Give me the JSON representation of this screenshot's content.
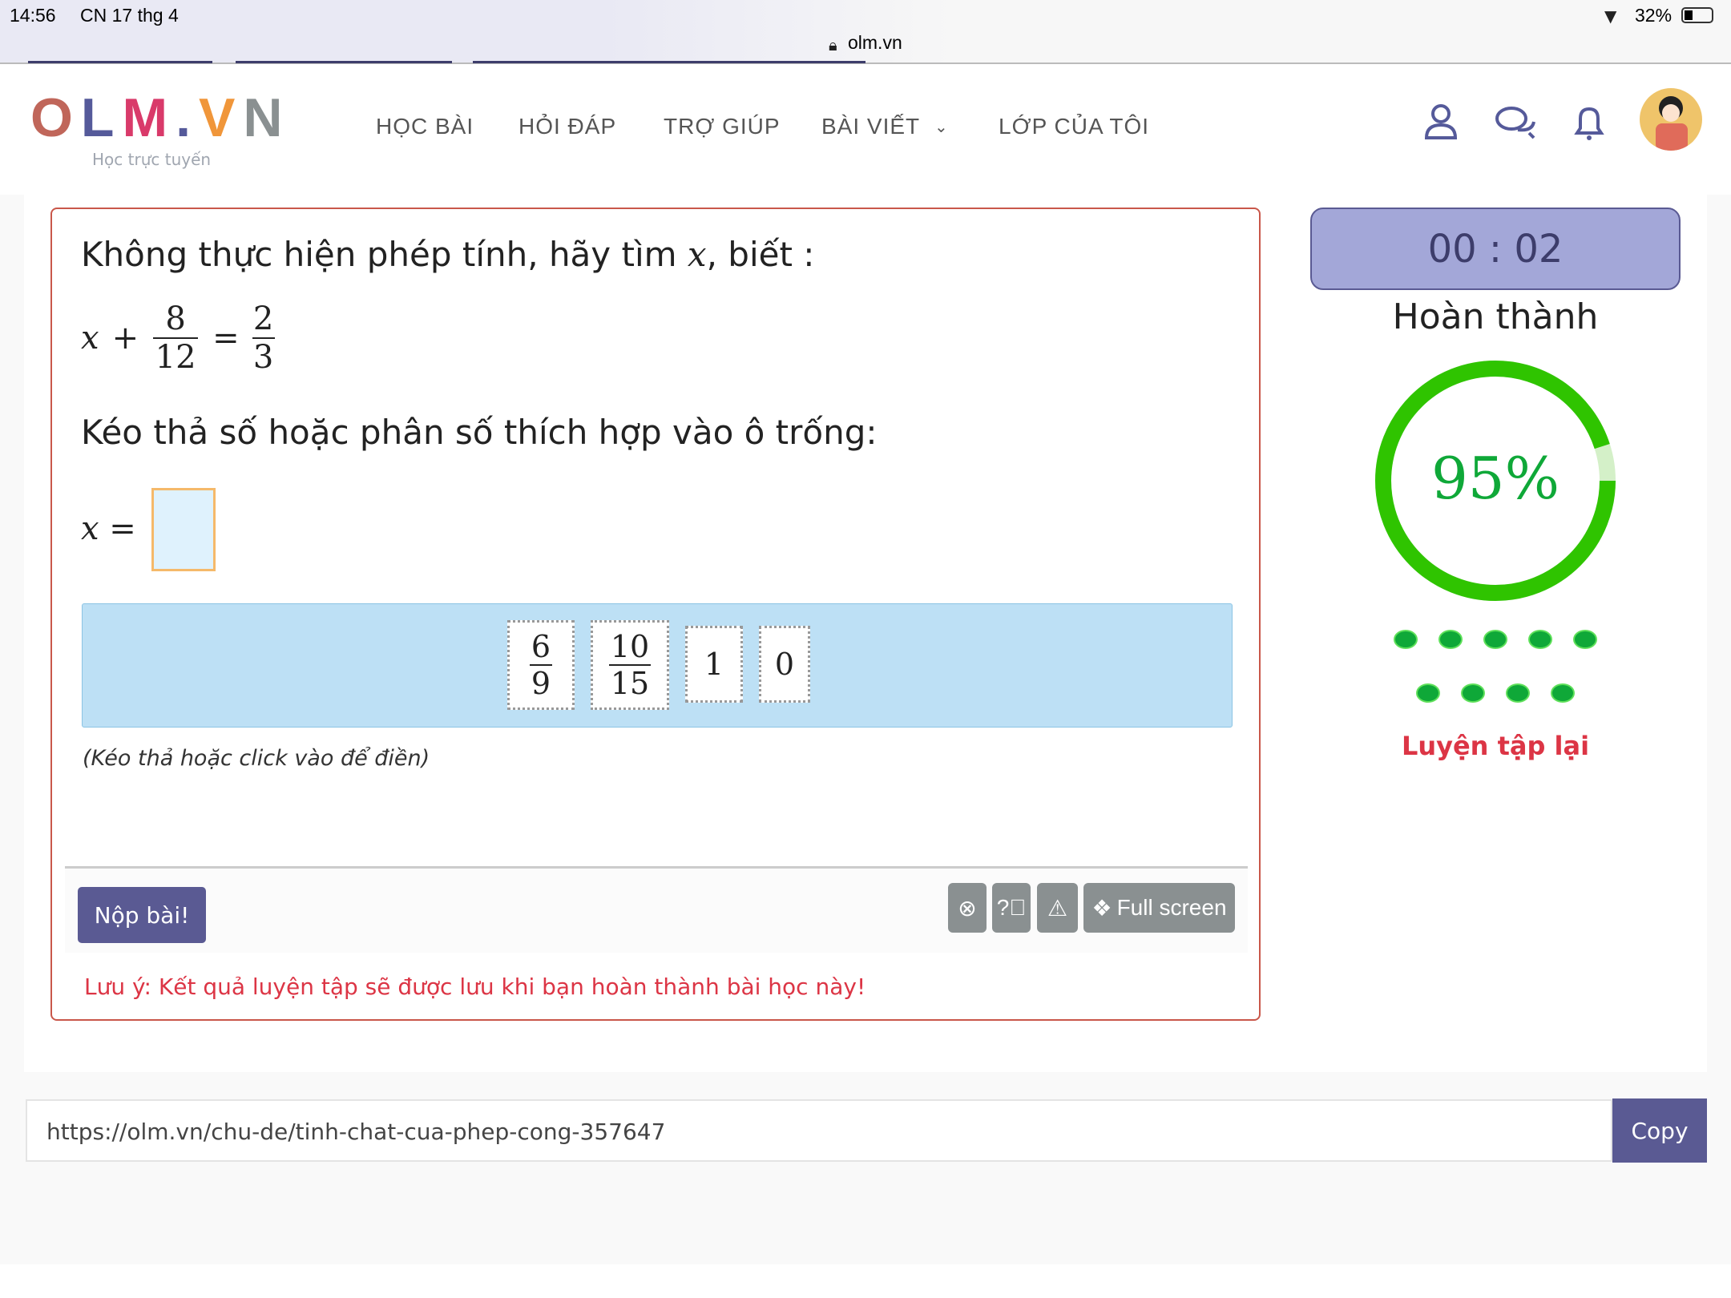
{
  "status_bar": {
    "time": "14:56",
    "date": "CN 17 thg 4",
    "battery": "32%",
    "url": "olm.vn"
  },
  "header": {
    "logo": {
      "letters": [
        "O",
        "L",
        "M",
        ".",
        "V",
        "N"
      ],
      "colors": [
        "#c0665a",
        "#555a9a",
        "#d93a6a",
        "#555a9a",
        "#f0963a",
        "#8a9091"
      ],
      "tagline": "Học trực tuyến"
    },
    "nav": [
      {
        "label": "HỌC BÀI"
      },
      {
        "label": "HỎI ĐÁP"
      },
      {
        "label": "TRỢ GIÚP"
      },
      {
        "label": "BÀI VIẾT",
        "has_dropdown": true
      },
      {
        "label": "LỚP CỦA TÔI"
      }
    ],
    "icons": [
      "user-icon",
      "chat-icon",
      "bell-icon",
      "avatar"
    ]
  },
  "question": {
    "prompt_before": "Không thực hiện phép tính, hãy tìm ",
    "variable": "x",
    "prompt_after": ", biết :",
    "equation": {
      "var": "x",
      "plus": "+",
      "num1": "8",
      "den1": "12",
      "equals": "=",
      "num2": "2",
      "den2": "3"
    },
    "instruction": "Kéo thả số hoặc phân số thích hợp vào ô trống:",
    "answer_label": "x =",
    "answer_value": "",
    "options": [
      {
        "num": "6",
        "den": "9"
      },
      {
        "num": "10",
        "den": "15"
      },
      {
        "value": "1"
      },
      {
        "value": "0"
      }
    ],
    "hint": "(Kéo thả hoặc click vào để điền)",
    "submit_label": "Nộp bài!",
    "tools": {
      "close_icon": "x-circle-icon",
      "help_icon": "question-circle-icon",
      "report_icon": "warning-icon",
      "fullscreen_label": "Full screen"
    },
    "note": "Lưu ý: Kết quả luyện tập sẽ được lưu khi bạn hoàn thành bài học này!"
  },
  "sidebar": {
    "timer": "00 : 02",
    "status": "Hoàn thành",
    "progress_label": "95%",
    "progress_percent": 95,
    "dots": 9,
    "retry_label": "Luyện tập lại",
    "colors": {
      "ring": "#2fc400",
      "dot": "#0fa838",
      "retry": "#dc3545"
    }
  },
  "share": {
    "url": "https://olm.vn/chu-de/tinh-chat-cua-phep-cong-357647",
    "copy_label": "Copy"
  }
}
